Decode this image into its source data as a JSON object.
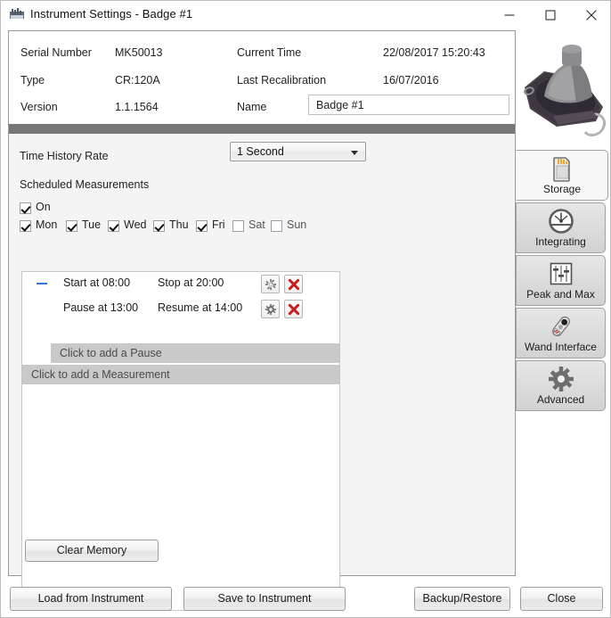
{
  "window": {
    "title": "Instrument Settings - Badge #1",
    "icon": "instrument-icon",
    "controls": {
      "minimize": "minimize-icon",
      "maximize": "maximize-icon",
      "close": "close-icon"
    }
  },
  "info": {
    "serial_label": "Serial Number",
    "serial_value": "MK50013",
    "type_label": "Type",
    "type_value": "CR:120A",
    "version_label": "Version",
    "version_value": "1.1.1564",
    "current_time_label": "Current Time",
    "current_time_value": "22/08/2017 15:20:43",
    "last_recal_label": "Last Recalibration",
    "last_recal_value": "16/07/2016",
    "name_label": "Name",
    "name_value": "Badge #1",
    "name_placeholder": "Badge #1"
  },
  "settings": {
    "time_history_rate_label": "Time History Rate",
    "time_history_rate_value": "1 Second",
    "time_history_rate_options": [
      "1 Second"
    ],
    "scheduled_measurements_label": "Scheduled Measurements",
    "on_label": "On",
    "on_checked": true,
    "days": [
      {
        "label": "Mon",
        "checked": true
      },
      {
        "label": "Tue",
        "checked": true
      },
      {
        "label": "Wed",
        "checked": true
      },
      {
        "label": "Thu",
        "checked": true
      },
      {
        "label": "Fri",
        "checked": true
      },
      {
        "label": "Sat",
        "checked": false
      },
      {
        "label": "Sun",
        "checked": false
      }
    ],
    "schedule": {
      "measurement": {
        "start_text": "Start at 08:00",
        "stop_text": "Stop at 20:00",
        "collapse_icon": "minus-icon",
        "settings_icon": "gear-icon",
        "delete_icon": "red-x-icon"
      },
      "pause": {
        "pause_text": "Pause at 13:00",
        "resume_text": "Resume at 14:00",
        "settings_icon": "gear-icon",
        "delete_icon": "red-x-icon"
      },
      "add_pause_text": "Click to add a Pause",
      "add_measurement_text": "Click to add a Measurement"
    },
    "clear_memory_label": "Clear Memory"
  },
  "tabs": [
    {
      "label": "Storage",
      "icon": "sd-card-icon",
      "selected": true
    },
    {
      "label": "Integrating",
      "icon": "gauge-icon",
      "selected": false
    },
    {
      "label": "Peak and Max",
      "icon": "sliders-icon",
      "selected": false
    },
    {
      "label": "Wand Interface",
      "icon": "wand-icon",
      "selected": false
    },
    {
      "label": "Advanced",
      "icon": "gear-icon",
      "selected": false
    }
  ],
  "device_image": "noise-dosimeter-badge-render",
  "footer": {
    "load_label": "Load from Instrument",
    "save_label": "Save to Instrument",
    "backup_label": "Backup/Restore",
    "close_label": "Close"
  },
  "colors": {
    "accent_blue": "#2e7bcf",
    "delete_red": "#c61c1c",
    "separator": "#777777",
    "panel_bg": "#f4f4f4",
    "row_highlight": "#c9c9c9"
  }
}
